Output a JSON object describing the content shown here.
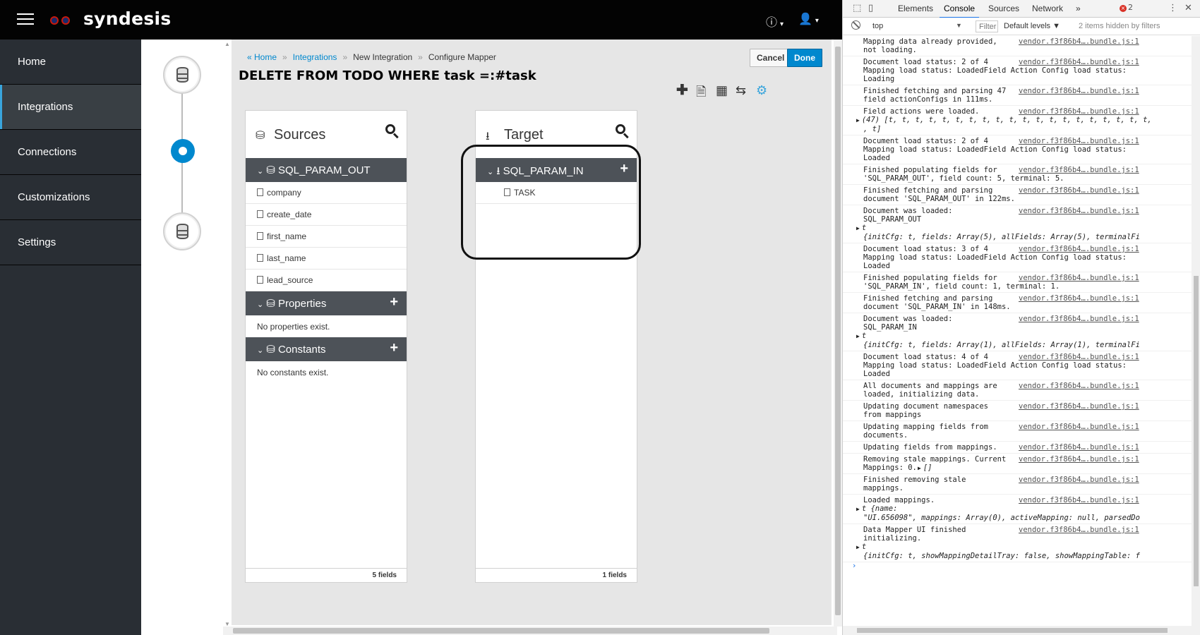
{
  "app": {
    "brand": "syndesis",
    "help_caret": "▾",
    "user_caret": "▾"
  },
  "sidebar": {
    "items": [
      {
        "label": "Home"
      },
      {
        "label": "Integrations"
      },
      {
        "label": "Connections"
      },
      {
        "label": "Customizations"
      },
      {
        "label": "Settings"
      }
    ]
  },
  "breadcrumb": {
    "home": "« Home",
    "integrations": "Integrations",
    "new_integration": "New Integration",
    "current": "Configure Mapper",
    "separator": "»"
  },
  "actions": {
    "cancel": "Cancel",
    "done": "Done"
  },
  "page_title": "DELETE FROM TODO WHERE task =:#task",
  "toolbar": {
    "icons": [
      "plus-icon",
      "document-icon",
      "table-icon",
      "swap-icon",
      "gear-icon"
    ],
    "accent": "#39a5dc"
  },
  "sources_panel": {
    "title": "Sources",
    "document": {
      "name": "SQL_PARAM_OUT",
      "fields": [
        "company",
        "create_date",
        "first_name",
        "last_name",
        "lead_source"
      ]
    },
    "properties": {
      "title": "Properties",
      "empty": "No properties exist."
    },
    "constants": {
      "title": "Constants",
      "empty": "No constants exist."
    },
    "footer": "5 fields"
  },
  "target_panel": {
    "title": "Target",
    "document": {
      "name": "SQL_PARAM_IN",
      "fields": [
        "TASK"
      ]
    },
    "footer": "1 fields"
  },
  "devtools": {
    "tabs": [
      "Elements",
      "Console",
      "Sources",
      "Network"
    ],
    "active_tab": "Console",
    "overflow": "»",
    "error_count": "2",
    "context": "top",
    "filter_placeholder": "Filter",
    "levels": "Default levels ▼",
    "hidden_note": "2 items hidden by filters",
    "source_link": "vendor.f3f86b4….bundle.js:1",
    "logs": [
      {
        "msg": "Mapping data already provided,\nnot loading."
      },
      {
        "msg": "Document load status: 2 of 4\nMapping load status: LoadedField Action Config load status:\nLoading"
      },
      {
        "msg": "Finished fetching and parsing 47\nfield actionConfigs in 111ms."
      },
      {
        "msg": "Field actions were loaded.",
        "obj": "(47) [t, t, t, t, t, t, t, t, t, t, t, t, t, t, t, t, t, t, t, t,\n, t]"
      },
      {
        "msg": "Document load status: 2 of 4\nMapping load status: LoadedField Action Config load status:\nLoaded"
      },
      {
        "msg": "Finished populating fields for\n'SQL_PARAM_OUT', field count: 5, terminal: 5."
      },
      {
        "msg": "Finished fetching and parsing\ndocument 'SQL_PARAM_OUT' in 122ms."
      },
      {
        "msg": "Document was loaded:\nSQL_PARAM_OUT",
        "obj": "t\n{initCfg: t, fields: Array(5), allFields: Array(5), terminalFi"
      },
      {
        "msg": "Document load status: 3 of 4\nMapping load status: LoadedField Action Config load status:\nLoaded"
      },
      {
        "msg": "Finished populating fields for\n'SQL_PARAM_IN', field count: 1, terminal: 1."
      },
      {
        "msg": "Finished fetching and parsing\ndocument 'SQL_PARAM_IN' in 148ms."
      },
      {
        "msg": "Document was loaded:\nSQL_PARAM_IN",
        "obj": "t\n{initCfg: t, fields: Array(1), allFields: Array(1), terminalFi"
      },
      {
        "msg": "Document load status: 4 of 4\nMapping load status: LoadedField Action Config load status:\nLoaded"
      },
      {
        "msg": "All documents and mappings are\nloaded, initializing data."
      },
      {
        "msg": "Updating document namespaces\nfrom mappings"
      },
      {
        "msg": "Updating mapping fields from\ndocuments."
      },
      {
        "msg": "Updating fields from mappings."
      },
      {
        "msg": "Removing stale mappings. Current\nMappings: 0.",
        "inline_obj": "[]"
      },
      {
        "msg": "Finished removing stale\nmappings."
      },
      {
        "msg": "Loaded mappings.",
        "obj": "t {name:\n\"UI.656098\", mappings: Array(0), activeMapping: null, parsedDo"
      },
      {
        "msg": "Data Mapper UI finished\ninitializing.",
        "obj": "t\n{initCfg: t, showMappingDetailTray: false, showMappingTable: f"
      }
    ],
    "prompt": "›"
  }
}
